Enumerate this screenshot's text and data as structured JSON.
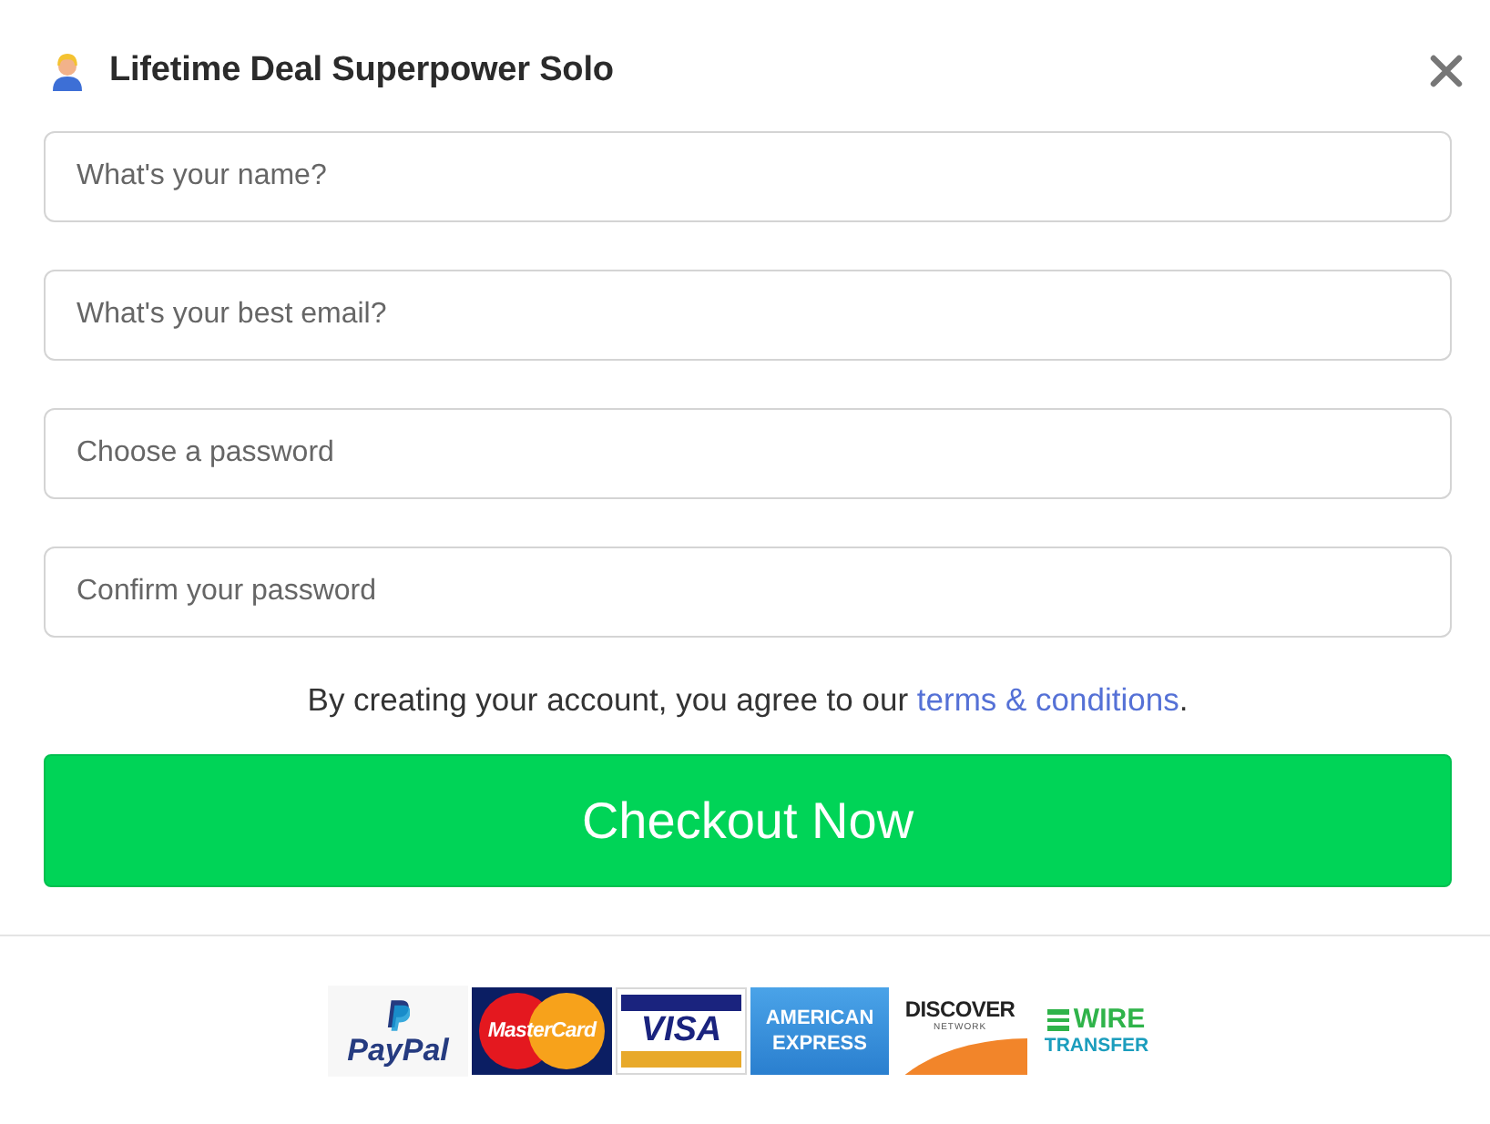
{
  "header": {
    "title": "Lifetime Deal Superpower Solo"
  },
  "fields": [
    {
      "placeholder": "What's your name?"
    },
    {
      "placeholder": "What's your best email?"
    },
    {
      "placeholder": "Choose a password"
    },
    {
      "placeholder": "Confirm your password"
    }
  ],
  "terms": {
    "text": "By creating your account, you agree to our ",
    "link": "terms & conditions",
    "end": "."
  },
  "checkout_button": {
    "label": "Checkout Now"
  },
  "payment_logos": [
    {
      "kind": "paypal",
      "text": "PayPal"
    },
    {
      "kind": "mastercard",
      "text": "MasterCard"
    },
    {
      "kind": "visa",
      "text": "VISA"
    },
    {
      "kind": "amex",
      "text": "AMERICAN EXPRESS"
    },
    {
      "kind": "discover",
      "text": "DISCOVER",
      "subtext": "NETWORK"
    },
    {
      "kind": "wire",
      "text": "WIRE",
      "subtext": "TRANSFER"
    }
  ]
}
